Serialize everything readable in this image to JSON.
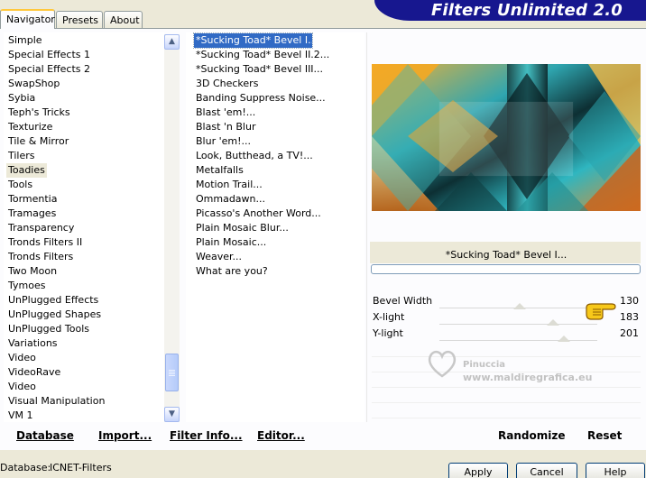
{
  "tabs": [
    {
      "label": "Navigator",
      "active": true
    },
    {
      "label": "Presets",
      "active": false
    },
    {
      "label": "About",
      "active": false
    }
  ],
  "banner": {
    "title": "Filters Unlimited 2.0"
  },
  "categories": [
    {
      "label": "Simple"
    },
    {
      "label": "Special Effects 1"
    },
    {
      "label": "Special Effects 2"
    },
    {
      "label": "SwapShop"
    },
    {
      "label": "Sybia"
    },
    {
      "label": "Teph's Tricks"
    },
    {
      "label": "Texturize"
    },
    {
      "label": "Tile & Mirror"
    },
    {
      "label": "Tilers"
    },
    {
      "label": "Toadies",
      "selected": true
    },
    {
      "label": "Tools"
    },
    {
      "label": "Tormentia"
    },
    {
      "label": "Tramages"
    },
    {
      "label": "Transparency"
    },
    {
      "label": "Tronds Filters II"
    },
    {
      "label": "Tronds Filters"
    },
    {
      "label": "Two Moon"
    },
    {
      "label": "Tymoes"
    },
    {
      "label": "UnPlugged Effects"
    },
    {
      "label": "UnPlugged Shapes"
    },
    {
      "label": "UnPlugged Tools"
    },
    {
      "label": "Variations"
    },
    {
      "label": "Video"
    },
    {
      "label": "VideoRave"
    },
    {
      "label": "Video"
    },
    {
      "label": "Visual Manipulation"
    },
    {
      "label": "VM 1"
    }
  ],
  "filters": [
    {
      "label": "*Sucking Toad*  Bevel I...",
      "selected": true
    },
    {
      "label": "*Sucking Toad*  Bevel II.2..."
    },
    {
      "label": "*Sucking Toad*  Bevel III..."
    },
    {
      "label": "3D Checkers"
    },
    {
      "label": "Banding Suppress Noise..."
    },
    {
      "label": "Blast 'em!..."
    },
    {
      "label": "Blast 'n Blur"
    },
    {
      "label": "Blur 'em!..."
    },
    {
      "label": "Look, Butthead, a TV!..."
    },
    {
      "label": "Metalfalls"
    },
    {
      "label": "Motion Trail..."
    },
    {
      "label": "Ommadawn..."
    },
    {
      "label": "Picasso's Another Word..."
    },
    {
      "label": "Plain Mosaic Blur..."
    },
    {
      "label": "Plain Mosaic..."
    },
    {
      "label": "Weaver..."
    },
    {
      "label": "What are you?"
    }
  ],
  "preview": {
    "filter_name": "*Sucking Toad*  Bevel I..."
  },
  "parameters": [
    {
      "label": "Bevel Width",
      "value": "130",
      "fraction": 0.51
    },
    {
      "label": "X-light",
      "value": "183",
      "fraction": 0.72
    },
    {
      "label": "Y-light",
      "value": "201",
      "fraction": 0.79
    }
  ],
  "watermark": {
    "line1": "Pinuccia",
    "line2": "www.maldiregrafica.eu"
  },
  "bottom_links": {
    "database": "Database",
    "import": "Import...",
    "filter_info": "Filter Info...",
    "editor": "Editor...",
    "randomize": "Randomize",
    "reset": "Reset"
  },
  "status": {
    "database_label": "Database:",
    "database_value": "ICNET-Filters"
  },
  "buttons": {
    "apply": "Apply",
    "cancel": "Cancel",
    "help": "Help"
  },
  "colors": {
    "banner": "#17178f",
    "selection": "#316ac5"
  }
}
